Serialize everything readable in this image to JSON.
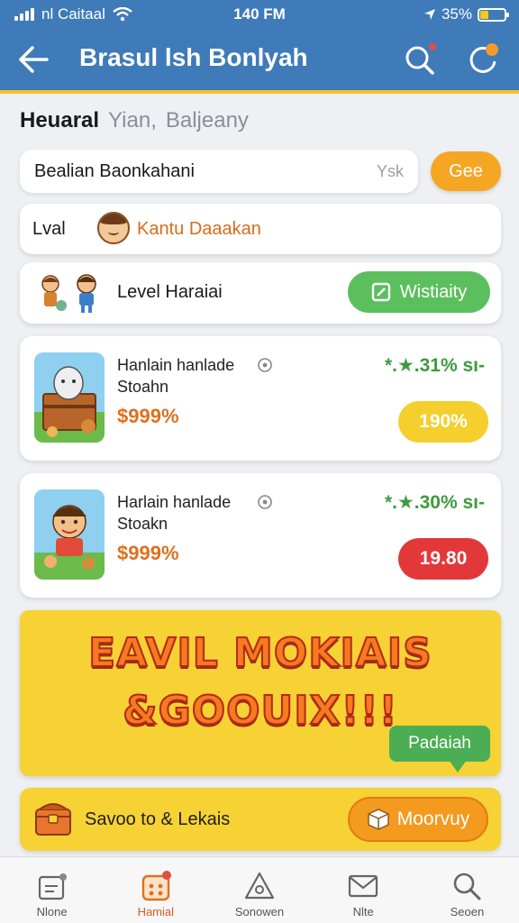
{
  "status_bar": {
    "carrier": "nl Caitaal",
    "time": "140 FM",
    "battery": "35%",
    "battery_level": 0.35
  },
  "header": {
    "title": "Brasul lsh Bonlyah"
  },
  "tabs": [
    {
      "label": "Heuaral",
      "active": true
    },
    {
      "label": "Yian,",
      "active": false
    },
    {
      "label": "Baljeany",
      "active": false
    }
  ],
  "search": {
    "value": "Bealian Baonkahani",
    "hint": "Ysk",
    "go_label": "Gee"
  },
  "level_row": {
    "label": "Lval",
    "value": "Kantu Daaakan"
  },
  "level2_row": {
    "label": "Level Haraiai",
    "button_label": "Wistiaity"
  },
  "products": [
    {
      "name": "Hanlain hanlade Stoahn",
      "price": "$999%",
      "rating": "*.★.31% sı-",
      "pill": "190%",
      "pill_color": "#f4cf2d"
    },
    {
      "name": "Harlain hanlade Stoakn",
      "price": "$999%",
      "rating": "*.★.30% sı-",
      "pill": "19.80",
      "pill_color": "#e2383a"
    }
  ],
  "banner": {
    "line1": "EAVIL MOKIAIS",
    "line2": "&GOOUIX!!!",
    "bubble": "Padaiah"
  },
  "promo": {
    "text": "Savoo to & Lekais",
    "button_label": "Moorvuy"
  },
  "bottom_nav": [
    {
      "label": "Nlone",
      "icon": "home-icon",
      "active": false
    },
    {
      "label": "Hamial",
      "icon": "game-icon",
      "active": true
    },
    {
      "label": "Sonowen",
      "icon": "triangle-icon",
      "active": false
    },
    {
      "label": "Nlte",
      "icon": "mail-icon",
      "active": false
    },
    {
      "label": "Seoen",
      "icon": "search-icon",
      "active": false
    }
  ],
  "colors": {
    "header": "#3f7ab9",
    "accent_orange": "#f5a623",
    "green": "#5cbf5e",
    "banner_yellow": "#f6d234",
    "red": "#e2383a"
  }
}
